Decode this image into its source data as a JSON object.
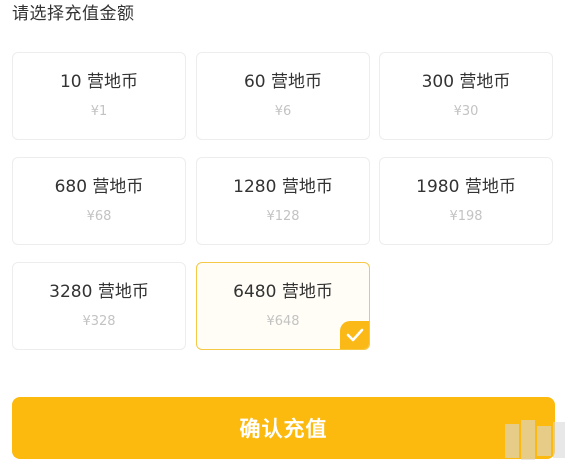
{
  "header": {
    "title": "请选择充值金额"
  },
  "options": [
    {
      "coins": "10 营地币",
      "price": "¥1"
    },
    {
      "coins": "60 营地币",
      "price": "¥6"
    },
    {
      "coins": "300 营地币",
      "price": "¥30"
    },
    {
      "coins": "680 营地币",
      "price": "¥68"
    },
    {
      "coins": "1280 营地币",
      "price": "¥128"
    },
    {
      "coins": "1980 营地币",
      "price": "¥198"
    },
    {
      "coins": "3280 营地币",
      "price": "¥328"
    },
    {
      "coins": "6480 营地币",
      "price": "¥648"
    }
  ],
  "selected_index": 7,
  "confirm_button": {
    "label": "确认充值"
  },
  "colors": {
    "accent": "#fcb90e",
    "selected_border": "#f5c845",
    "price_text": "#c3c3c3"
  },
  "icons": {
    "check": "checkmark-icon"
  }
}
